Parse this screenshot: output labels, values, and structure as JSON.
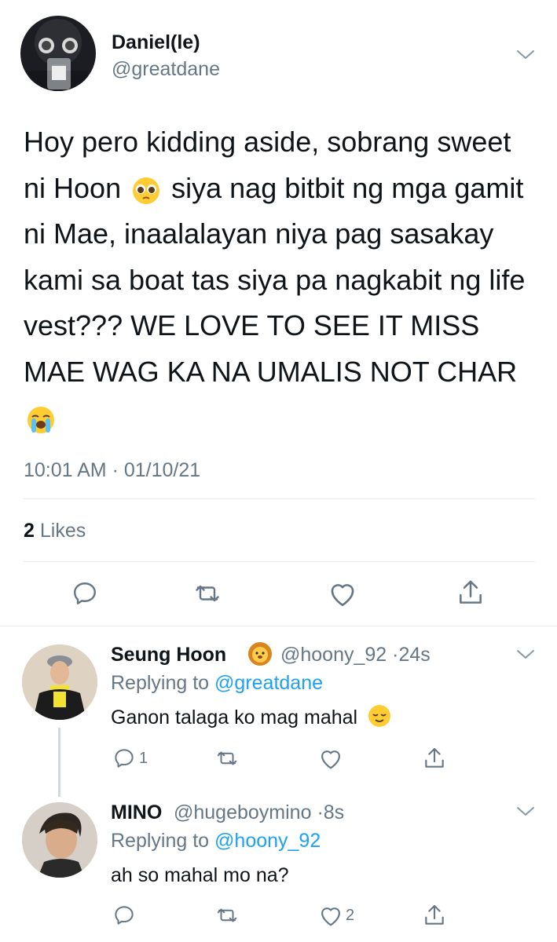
{
  "main_tweet": {
    "display_name": "Daniel(le)",
    "handle": "@greatdane",
    "text_part1": "Hoy pero kidding aside, sobrang sweet ni Hoon",
    "emoji1": "pleading-face",
    "text_part2": "siya nag bitbit ng mga gamit ni Mae, inaalalayan niya pag sasakay kami sa boat tas siya pa nagkabit ng life vest??? WE LOVE TO SEE IT MISS MAE WAG KA NA UMALIS NOT CHAR",
    "emoji2": "loudly-crying-face",
    "timestamp": "10:01 AM · 01/10/21",
    "likes_count": "2",
    "likes_label": "Likes"
  },
  "replies": [
    {
      "display_name": "Seung Hoon",
      "name_emoji": "lion-face",
      "handle": "@hoony_92",
      "dot": "·",
      "time": "24s",
      "replying_label": "Replying to",
      "replying_to": "@greatdane",
      "text": "Ganon talaga ko mag mahal",
      "text_emoji": "relieved-face",
      "reply_count": "1",
      "like_count": ""
    },
    {
      "display_name": "MINO",
      "handle": "@hugeboymino",
      "dot": "·",
      "time": "8s",
      "replying_label": "Replying to",
      "replying_to": "@hoony_92",
      "text": "ah so mahal mo na?",
      "reply_count": "",
      "like_count": "2"
    }
  ],
  "colors": {
    "accent": "#1da1f2",
    "muted": "#657786",
    "text": "#0f1419",
    "divider": "#e6ecf0"
  }
}
